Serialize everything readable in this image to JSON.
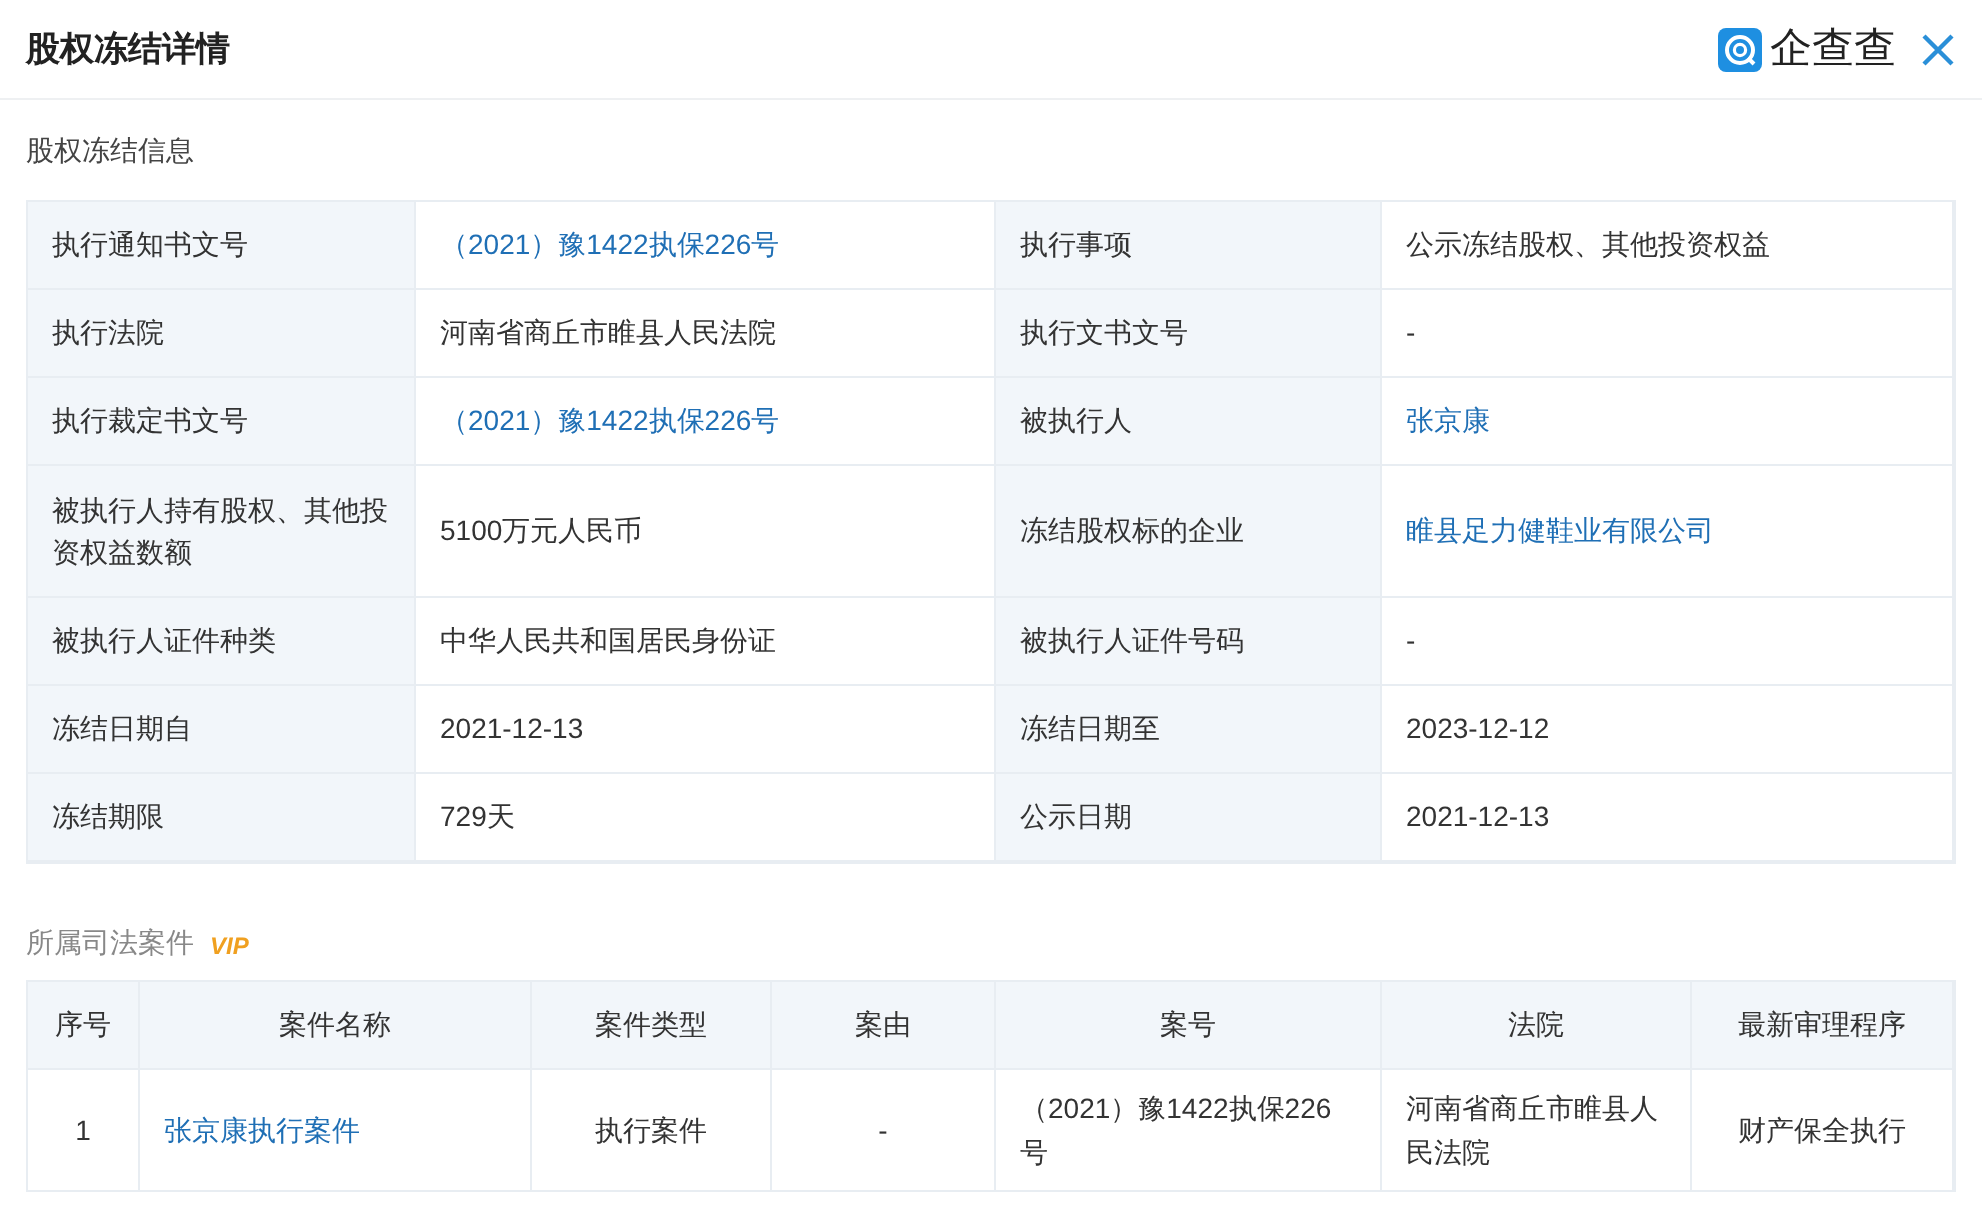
{
  "header": {
    "title": "股权冻结详情",
    "logo_text": "企查查"
  },
  "freeze_info": {
    "title": "股权冻结信息",
    "rows": [
      [
        {
          "kind": "label",
          "text": "执行通知书文号"
        },
        {
          "kind": "link",
          "text": "（2021）豫1422执保226号"
        },
        {
          "kind": "label",
          "text": "执行事项"
        },
        {
          "kind": "text",
          "text": "公示冻结股权、其他投资权益"
        }
      ],
      [
        {
          "kind": "label",
          "text": "执行法院"
        },
        {
          "kind": "text",
          "text": "河南省商丘市睢县人民法院"
        },
        {
          "kind": "label",
          "text": "执行文书文号"
        },
        {
          "kind": "text",
          "text": "-"
        }
      ],
      [
        {
          "kind": "label",
          "text": "执行裁定书文号"
        },
        {
          "kind": "link",
          "text": "（2021）豫1422执保226号"
        },
        {
          "kind": "label",
          "text": "被执行人"
        },
        {
          "kind": "link",
          "text": "张京康"
        }
      ],
      [
        {
          "kind": "label",
          "text": "被执行人持有股权、其他投资权益数额"
        },
        {
          "kind": "text",
          "text": "5100万元人民币"
        },
        {
          "kind": "label",
          "text": "冻结股权标的企业"
        },
        {
          "kind": "link",
          "text": "睢县足力健鞋业有限公司"
        }
      ],
      [
        {
          "kind": "label",
          "text": "被执行人证件种类"
        },
        {
          "kind": "text",
          "text": "中华人民共和国居民身份证"
        },
        {
          "kind": "label",
          "text": "被执行人证件号码"
        },
        {
          "kind": "text",
          "text": "-"
        }
      ],
      [
        {
          "kind": "label",
          "text": "冻结日期自"
        },
        {
          "kind": "text",
          "text": "2021-12-13"
        },
        {
          "kind": "label",
          "text": "冻结日期至"
        },
        {
          "kind": "text",
          "text": "2023-12-12"
        }
      ],
      [
        {
          "kind": "label",
          "text": "冻结期限"
        },
        {
          "kind": "text",
          "text": "729天"
        },
        {
          "kind": "label",
          "text": "公示日期"
        },
        {
          "kind": "text",
          "text": "2021-12-13"
        }
      ]
    ]
  },
  "cases": {
    "title": "所属司法案件",
    "badge": "VIP",
    "columns": [
      "序号",
      "案件名称",
      "案件类型",
      "案由",
      "案号",
      "法院",
      "最新审理程序"
    ],
    "rows": [
      [
        {
          "kind": "text",
          "text": "1"
        },
        {
          "kind": "link",
          "text": "张京康执行案件"
        },
        {
          "kind": "text",
          "text": "执行案件"
        },
        {
          "kind": "text",
          "text": "-"
        },
        {
          "kind": "text",
          "text": "（2021）豫1422执保226号"
        },
        {
          "kind": "text",
          "text": "河南省商丘市睢县人民法院"
        },
        {
          "kind": "text",
          "text": "财产保全执行"
        }
      ]
    ]
  }
}
